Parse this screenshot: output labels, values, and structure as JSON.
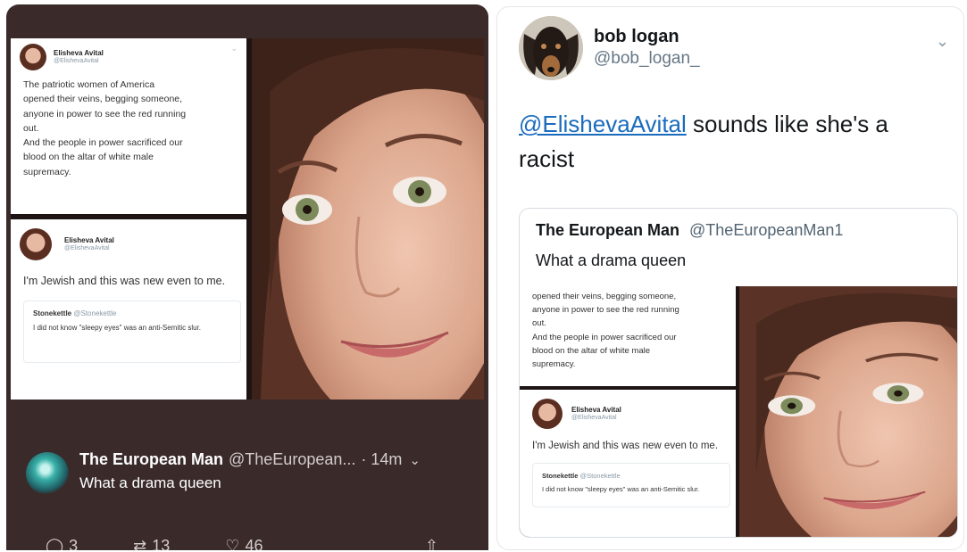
{
  "left_tweet": {
    "card1": {
      "author": "Elisheva Avital",
      "handle": "@ElishevaAvital",
      "lines": [
        "The patriotic women of America",
        "opened their veins, begging someone,",
        "anyone in power to see the red running",
        "out.",
        "And the people in power sacrificed our",
        "blood on the altar of white male",
        "supremacy."
      ]
    },
    "card2": {
      "author": "Elisheva Avital",
      "handle": "@ElishevaAvital",
      "body": "I'm Jewish and this was new even to me.",
      "quote": {
        "author": "Stonekettle",
        "handle": "@Stonekettle",
        "body": "I did not know \"sleepy eyes\" was an anti-Semitic slur."
      }
    },
    "reply": {
      "author": "The European Man",
      "handle": "@TheEuropean...",
      "time": "· 14m",
      "body": "What a drama queen"
    },
    "actions": {
      "replies": "3",
      "retweets": "13",
      "likes": "46"
    }
  },
  "right_tweet": {
    "author": "bob logan",
    "handle": "@bob_logan_",
    "mention": "@ElishevaAvital",
    "text": "sounds like she's a racist",
    "quoted": {
      "author": "The European Man",
      "handle": "@TheEuropeanMan1",
      "body": "What a drama queen",
      "card1_lines": [
        "opened their veins, begging someone,",
        "anyone in power to see the red running",
        "out.",
        "And the people in power sacrificed our",
        "blood on the altar of white male",
        "supremacy."
      ],
      "card2": {
        "author": "Elisheva Avital",
        "handle": "@ElishevaAvital",
        "body": "I'm Jewish and this was new even to me.",
        "quote_author": "Stonekettle",
        "quote_handle": "@Stonekettle",
        "quote_body": "I did not know \"sleepy eyes\" was an anti-Semitic slur."
      }
    }
  },
  "colors": {
    "dark_panel": "#3a2a2a",
    "link": "#1b6bbd",
    "muted": "#657786"
  },
  "icons": [
    "reply-icon",
    "retweet-icon",
    "like-icon",
    "share-icon",
    "chevron-down-icon"
  ]
}
